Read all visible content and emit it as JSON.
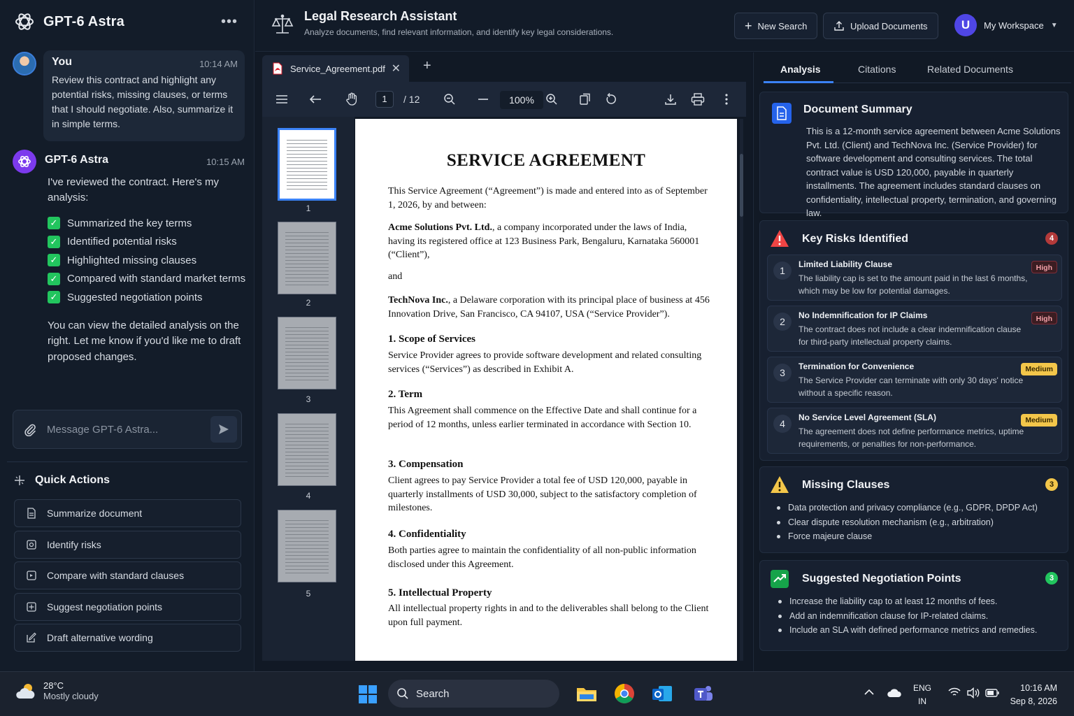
{
  "app": {
    "name": "GPT-6 Astra"
  },
  "chat": {
    "user": {
      "name": "You",
      "time": "10:14 AM",
      "text": "Review this contract and highlight any potential risks, missing clauses, or terms that I should negotiate. Also, summarize it in simple terms."
    },
    "bot": {
      "name": "GPT-6 Astra",
      "time": "10:15 AM",
      "intro": "I've reviewed the contract. Here's my analysis:",
      "checklist": [
        "Summarized the key terms",
        "Identified potential risks",
        "Highlighted missing clauses",
        "Compared with standard market terms",
        "Suggested negotiation points"
      ],
      "outro": "You can view the detailed analysis on the right. Let me know if you'd like me to draft proposed changes."
    },
    "composer_placeholder": "Message GPT-6 Astra..."
  },
  "quick_actions": {
    "title": "Quick Actions",
    "items": [
      "Summarize document",
      "Identify risks",
      "Compare with standard clauses",
      "Suggest negotiation points",
      "Draft alternative wording"
    ]
  },
  "header": {
    "title": "Legal Research Assistant",
    "subtitle": "Analyze documents, find relevant information, and identify key legal considerations.",
    "new_search": "New Search",
    "upload": "Upload Documents",
    "workspace": "My Workspace",
    "avatar_letter": "U"
  },
  "viewer": {
    "file_name": "Service_Agreement.pdf",
    "page_current": "1",
    "page_total": "/ 12",
    "zoom": "100%",
    "thumb_numbers": [
      "1",
      "2",
      "3",
      "4",
      "5"
    ]
  },
  "document": {
    "title": "SERVICE AGREEMENT",
    "intro": "This Service Agreement (“Agreement”) is made and entered into as of September 1, 2026, by and between:",
    "party1_name": "Acme Solutions Pvt. Ltd.",
    "party1_text": ", a company incorporated under the laws of India, having its registered office at 123 Business Park, Bengaluru, Karnataka 560001 (“Client”),",
    "and": "and",
    "party2_name": "TechNova Inc.",
    "party2_text": ", a Delaware corporation with its principal place of business at 456 Innovation Drive, San Francisco, CA 94107, USA (“Service Provider”).",
    "sections": [
      {
        "heading": "1. Scope of Services",
        "text": "Service Provider agrees to provide software development and related consulting services (“Services”) as described in Exhibit A."
      },
      {
        "heading": "2. Term",
        "text": "This Agreement shall commence on the Effective Date and shall continue for a period of 12 months, unless earlier terminated in accordance with Section 10."
      },
      {
        "heading": "3. Compensation",
        "text": "Client agrees to pay Service Provider a total fee of USD 120,000, payable in quarterly installments of USD 30,000, subject to the satisfactory completion of milestones."
      },
      {
        "heading": "4. Confidentiality",
        "text": "Both parties agree to maintain the confidentiality of all non-public information disclosed under this Agreement."
      },
      {
        "heading": "5. Intellectual Property",
        "text": "All intellectual property rights in and to the deliverables shall belong to the Client upon full payment."
      }
    ]
  },
  "analysis": {
    "tabs": [
      "Analysis",
      "Citations",
      "Related Documents"
    ],
    "summary": {
      "title": "Document Summary",
      "text": "This is a 12-month service agreement between Acme Solutions Pvt. Ltd. (Client) and TechNova Inc. (Service Provider) for software development and consulting services. The total contract value is USD 120,000, payable in quarterly installments. The agreement includes standard clauses on confidentiality, intellectual property, termination, and governing law."
    },
    "risks": {
      "title": "Key Risks Identified",
      "count": "4",
      "items": [
        {
          "num": "1",
          "title": "Limited Liability Clause",
          "desc": "The liability cap is set to the amount paid in the last 6 months, which may be low for potential damages.",
          "severity": "High"
        },
        {
          "num": "2",
          "title": "No Indemnification for IP Claims",
          "desc": "The contract does not include a clear indemnification clause for third-party intellectual property claims.",
          "severity": "High"
        },
        {
          "num": "3",
          "title": "Termination for Convenience",
          "desc": "The Service Provider can terminate with only 30 days' notice without a specific reason.",
          "severity": "Medium"
        },
        {
          "num": "4",
          "title": "No Service Level Agreement (SLA)",
          "desc": "The agreement does not define performance metrics, uptime requirements, or penalties for non-performance.",
          "severity": "Medium"
        }
      ]
    },
    "missing": {
      "title": "Missing Clauses",
      "count": "3",
      "items": [
        "Data protection and privacy compliance (e.g., GDPR, DPDP Act)",
        "Clear dispute resolution mechanism (e.g., arbitration)",
        "Force majeure clause"
      ]
    },
    "negotiation": {
      "title": "Suggested Negotiation Points",
      "count": "3",
      "items": [
        "Increase the liability cap to at least 12 months of fees.",
        "Add an indemnification clause for IP-related claims.",
        "Include an SLA with defined performance metrics and remedies."
      ]
    }
  },
  "taskbar": {
    "temp": "28°C",
    "weather": "Mostly cloudy",
    "search": "Search",
    "lang1": "ENG",
    "lang2": "IN",
    "time": "10:16 AM",
    "date": "Sep 8, 2026"
  },
  "colors": {
    "accent": "#3b82f6",
    "success": "#22c55e",
    "danger": "#ef4444",
    "warning": "#f3c64a",
    "bot": "#7c3aed"
  }
}
